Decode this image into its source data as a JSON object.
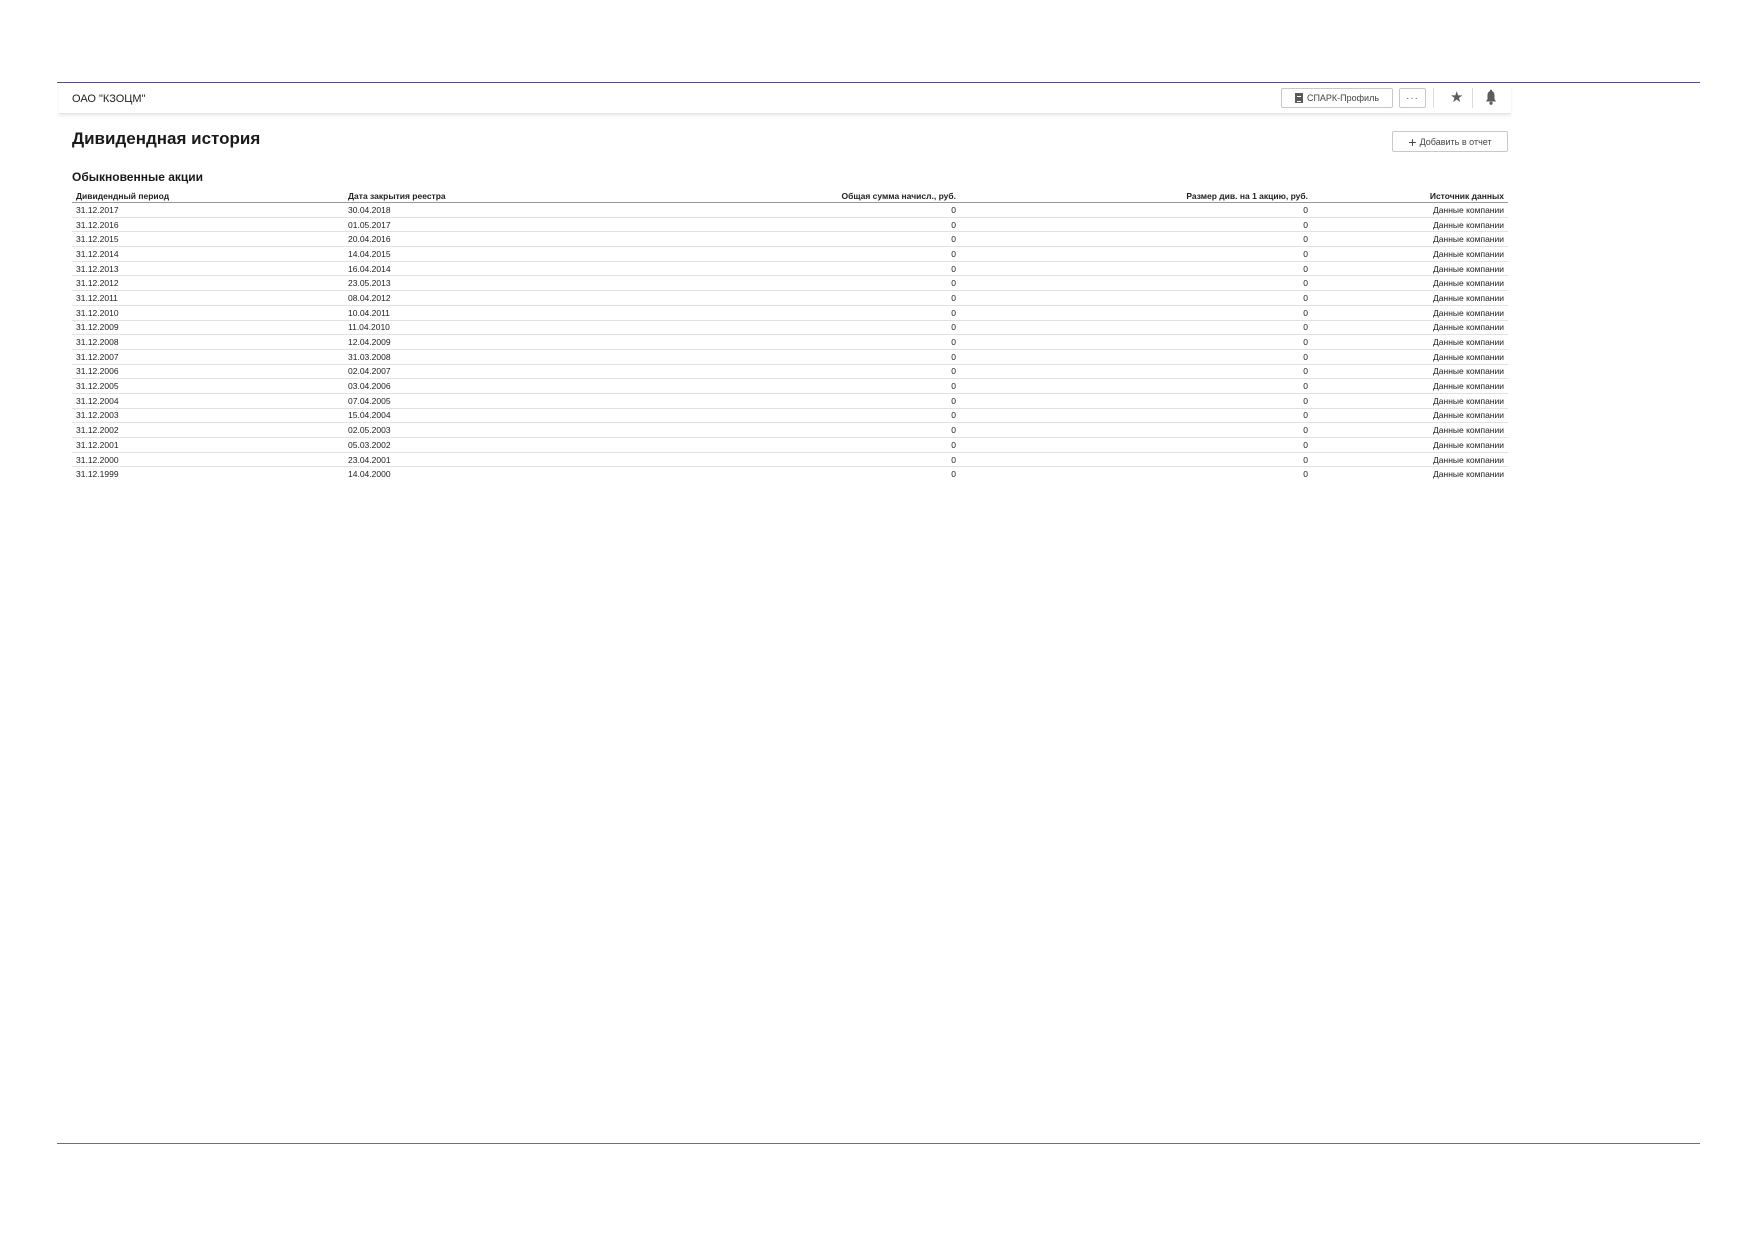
{
  "header": {
    "company_name": "ОАО \"КЗОЦМ\"",
    "spark_button_label": "СПАРК-Профиль",
    "more_button_label": "···",
    "icons": [
      "document-icon",
      "more-icon",
      "star-icon",
      "bell-icon"
    ]
  },
  "section": {
    "title": "Дивидендная история",
    "add_button_label": "Добавить в отчет",
    "subsection_title": "Обыкновенные акции"
  },
  "table": {
    "columns": [
      "Дивидендный период",
      "Дата закрытия реестра",
      "Общая сумма начисл., руб.",
      "Размер див. на 1 акцию, руб.",
      "Источник данных"
    ],
    "rows": [
      [
        "31.12.2017",
        "30.04.2018",
        "0",
        "0",
        "Данные компании"
      ],
      [
        "31.12.2016",
        "01.05.2017",
        "0",
        "0",
        "Данные компании"
      ],
      [
        "31.12.2015",
        "20.04.2016",
        "0",
        "0",
        "Данные компании"
      ],
      [
        "31.12.2014",
        "14.04.2015",
        "0",
        "0",
        "Данные компании"
      ],
      [
        "31.12.2013",
        "16.04.2014",
        "0",
        "0",
        "Данные компании"
      ],
      [
        "31.12.2012",
        "23.05.2013",
        "0",
        "0",
        "Данные компании"
      ],
      [
        "31.12.2011",
        "08.04.2012",
        "0",
        "0",
        "Данные компании"
      ],
      [
        "31.12.2010",
        "10.04.2011",
        "0",
        "0",
        "Данные компании"
      ],
      [
        "31.12.2009",
        "11.04.2010",
        "0",
        "0",
        "Данные компании"
      ],
      [
        "31.12.2008",
        "12.04.2009",
        "0",
        "0",
        "Данные компании"
      ],
      [
        "31.12.2007",
        "31.03.2008",
        "0",
        "0",
        "Данные компании"
      ],
      [
        "31.12.2006",
        "02.04.2007",
        "0",
        "0",
        "Данные компании"
      ],
      [
        "31.12.2005",
        "03.04.2006",
        "0",
        "0",
        "Данные компании"
      ],
      [
        "31.12.2004",
        "07.04.2005",
        "0",
        "0",
        "Данные компании"
      ],
      [
        "31.12.2003",
        "15.04.2004",
        "0",
        "0",
        "Данные компании"
      ],
      [
        "31.12.2002",
        "02.05.2003",
        "0",
        "0",
        "Данные компании"
      ],
      [
        "31.12.2001",
        "05.03.2002",
        "0",
        "0",
        "Данные компании"
      ],
      [
        "31.12.2000",
        "23.04.2001",
        "0",
        "0",
        "Данные компании"
      ],
      [
        "31.12.1999",
        "14.04.2000",
        "0",
        "0",
        "Данные компании"
      ]
    ]
  },
  "colors": {
    "top_rule": "#55507a",
    "bottom_rule": "#6e6e80",
    "text": "#1a1a1a"
  }
}
